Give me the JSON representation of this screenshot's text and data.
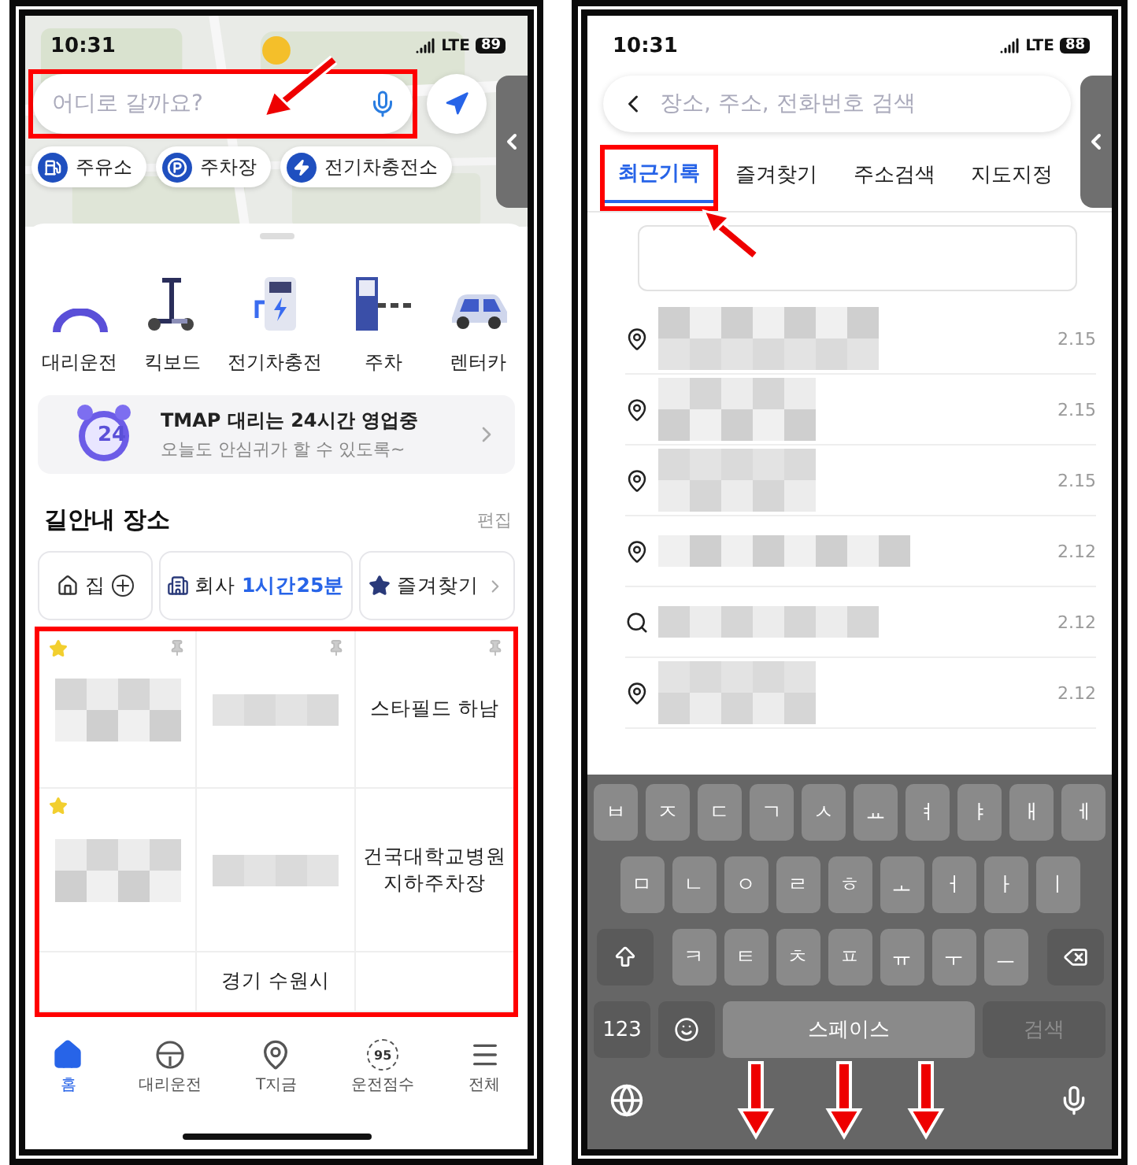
{
  "left_screen": {
    "status_bar": {
      "time": "10:31",
      "network": "LTE",
      "battery": "89"
    },
    "search": {
      "placeholder": "어디로 갈까요?"
    },
    "chips": [
      {
        "kind": "fuel",
        "label": "주유소"
      },
      {
        "kind": "parking",
        "label": "주차장"
      },
      {
        "kind": "ev",
        "label": "전기차충전소"
      }
    ],
    "services": [
      {
        "kind": "driver",
        "label": "대리운전"
      },
      {
        "kind": "scooter",
        "label": "킥보드"
      },
      {
        "kind": "charger",
        "label": "전기차충전"
      },
      {
        "kind": "parking",
        "label": "주차"
      },
      {
        "kind": "car",
        "label": "렌터카"
      }
    ],
    "banner": {
      "badge": "24",
      "title": "TMAP 대리는 24시간 영업중",
      "subtitle": "오늘도 안심귀가 할 수 있도록~"
    },
    "places": {
      "title": "길안내 장소",
      "edit": "편집",
      "shortcuts": [
        {
          "kind": "home",
          "label": "집"
        },
        {
          "kind": "work",
          "label": "회사",
          "eta": "1시간25분"
        },
        {
          "kind": "favorites",
          "label": "즐겨찾기"
        }
      ],
      "tiles": [
        {
          "kind": "blurred",
          "favorite": true,
          "pinned": true
        },
        {
          "kind": "blurred",
          "favorite": false,
          "pinned": true
        },
        {
          "kind": "text",
          "label": "스타필드 하남",
          "favorite": false,
          "pinned": true
        },
        {
          "kind": "blurred",
          "favorite": true,
          "pinned": false
        },
        {
          "kind": "blurred",
          "favorite": false,
          "pinned": false
        },
        {
          "kind": "text",
          "label": "건국대학교병원 지하주차장",
          "favorite": false,
          "pinned": false
        },
        {
          "kind": "empty",
          "favorite": false,
          "pinned": false
        },
        {
          "kind": "text",
          "label": "경기 수원시",
          "favorite": false,
          "pinned": false
        },
        {
          "kind": "empty",
          "favorite": false,
          "pinned": false
        }
      ]
    },
    "tab_bar": [
      {
        "kind": "home",
        "label": "홈",
        "selected": true
      },
      {
        "kind": "wheel",
        "label": "대리운전",
        "selected": false
      },
      {
        "kind": "pin",
        "label": "T지금",
        "selected": false
      },
      {
        "kind": "score",
        "label": "운전점수",
        "badge": "95",
        "selected": false
      },
      {
        "kind": "menu",
        "label": "전체",
        "selected": false
      }
    ]
  },
  "right_screen": {
    "status_bar": {
      "time": "10:31",
      "network": "LTE",
      "battery": "88"
    },
    "search": {
      "placeholder": "장소, 주소, 전화번호 검색"
    },
    "tabs": [
      {
        "label": "최근기록",
        "selected": true
      },
      {
        "label": "즐겨찾기",
        "selected": false
      },
      {
        "label": "주소검색",
        "selected": false
      },
      {
        "label": "지도지정",
        "selected": false
      }
    ],
    "recent": [
      {
        "kind": "place",
        "date": "2.15"
      },
      {
        "kind": "place",
        "date": "2.15"
      },
      {
        "kind": "place",
        "date": "2.15"
      },
      {
        "kind": "place",
        "date": "2.12"
      },
      {
        "kind": "search",
        "date": "2.12"
      },
      {
        "kind": "place",
        "date": "2.12"
      }
    ],
    "keyboard": {
      "rows": [
        [
          "ㅂ",
          "ㅈ",
          "ㄷ",
          "ㄱ",
          "ㅅ",
          "ㅛ",
          "ㅕ",
          "ㅑ",
          "ㅐ",
          "ㅔ"
        ],
        [
          "ㅁ",
          "ㄴ",
          "ㅇ",
          "ㄹ",
          "ㅎ",
          "ㅗ",
          "ㅓ",
          "ㅏ",
          "ㅣ"
        ],
        [
          "ㅋ",
          "ㅌ",
          "ㅊ",
          "ㅍ",
          "ㅠ",
          "ㅜ",
          "ㅡ"
        ]
      ],
      "numbers": "123",
      "space": "스페이스",
      "action": {
        "label": "검색",
        "disabled": true
      }
    }
  }
}
